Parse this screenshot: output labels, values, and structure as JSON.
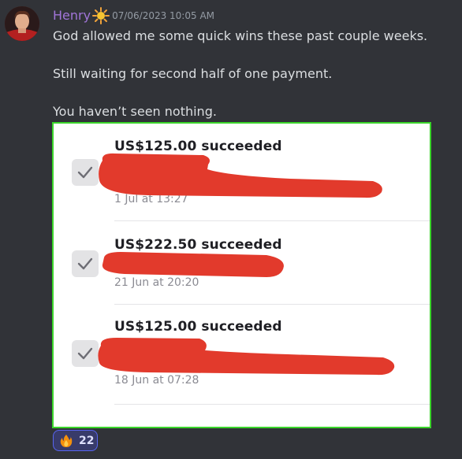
{
  "message": {
    "author": {
      "name": "Henry",
      "name_color": "#a175d8",
      "avatar_icon": "avatar",
      "badge_icon": "sun-emoji-icon"
    },
    "timestamp": "07/06/2023 10:05 AM",
    "lines": [
      "God allowed me some quick wins these past couple weeks.",
      "Still waiting for second half of one payment.",
      "You haven’t seen nothing."
    ]
  },
  "attachment": {
    "border_color": "#3bd52b",
    "transactions": [
      {
        "amount": "US$125.00 succeeded",
        "date": "1 Jul at 13:27",
        "icon": "checkmark-icon"
      },
      {
        "amount": "US$222.50 succeeded",
        "date": "21 Jun at 20:20",
        "icon": "checkmark-icon"
      },
      {
        "amount": "US$125.00 succeeded",
        "date": "18 Jun at 07:28",
        "icon": "checkmark-icon"
      }
    ],
    "redaction_color": "#e23a2c"
  },
  "reaction": {
    "emoji_icon": "fire-emoji-icon",
    "count": "22"
  },
  "colors": {
    "background": "#313338",
    "text": "#dbdee1",
    "timestamp": "#949ba4",
    "reaction_border": "#5865f2"
  }
}
